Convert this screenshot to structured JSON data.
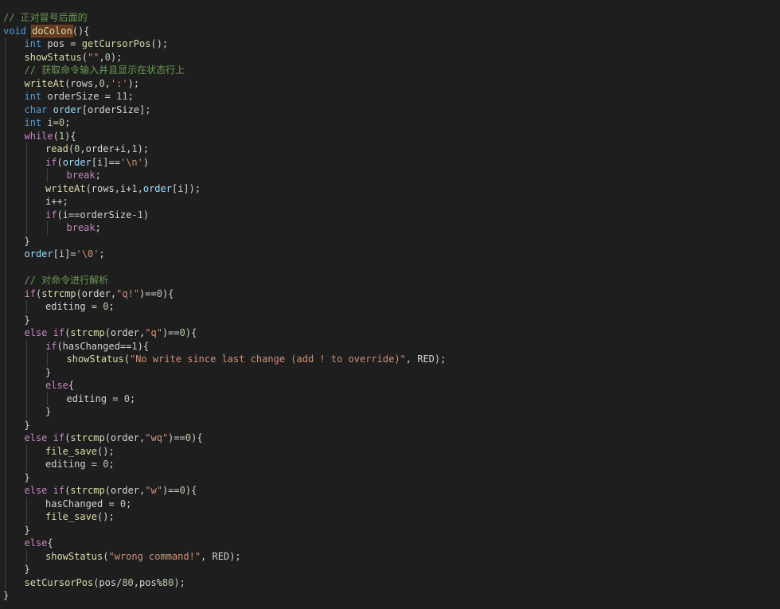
{
  "editor": {
    "lines": [
      {
        "indent": 0,
        "tokens": [
          {
            "t": "// 正对冒号后面的",
            "c": "comment"
          }
        ]
      },
      {
        "indent": 0,
        "tokens": [
          {
            "t": "void",
            "c": "keyword"
          },
          {
            "t": " ",
            "c": "plain"
          },
          {
            "t": "doColon",
            "c": "func",
            "hl": true
          },
          {
            "t": "(){",
            "c": "plain"
          }
        ]
      },
      {
        "indent": 1,
        "tokens": [
          {
            "t": "int",
            "c": "keyword"
          },
          {
            "t": " pos = ",
            "c": "plain"
          },
          {
            "t": "getCursorPos",
            "c": "func"
          },
          {
            "t": "();",
            "c": "plain"
          }
        ]
      },
      {
        "indent": 1,
        "tokens": [
          {
            "t": "showStatus",
            "c": "func"
          },
          {
            "t": "(",
            "c": "plain"
          },
          {
            "t": "\"\"",
            "c": "str"
          },
          {
            "t": ",",
            "c": "plain"
          },
          {
            "t": "0",
            "c": "num"
          },
          {
            "t": ");",
            "c": "plain"
          }
        ]
      },
      {
        "indent": 1,
        "tokens": [
          {
            "t": "// 获取命令输入并且显示在状态行上",
            "c": "comment"
          }
        ]
      },
      {
        "indent": 1,
        "tokens": [
          {
            "t": "writeAt",
            "c": "func"
          },
          {
            "t": "(rows,",
            "c": "plain"
          },
          {
            "t": "0",
            "c": "num"
          },
          {
            "t": ",",
            "c": "plain"
          },
          {
            "t": "':'",
            "c": "str"
          },
          {
            "t": ");",
            "c": "plain"
          }
        ]
      },
      {
        "indent": 1,
        "tokens": [
          {
            "t": "int",
            "c": "keyword"
          },
          {
            "t": " orderSize = ",
            "c": "plain"
          },
          {
            "t": "11",
            "c": "num"
          },
          {
            "t": ";",
            "c": "plain"
          }
        ]
      },
      {
        "indent": 1,
        "tokens": [
          {
            "t": "char",
            "c": "keyword"
          },
          {
            "t": " ",
            "c": "plain"
          },
          {
            "t": "order",
            "c": "var"
          },
          {
            "t": "[orderSize];",
            "c": "plain"
          }
        ]
      },
      {
        "indent": 1,
        "tokens": [
          {
            "t": "int",
            "c": "keyword"
          },
          {
            "t": " i=",
            "c": "plain"
          },
          {
            "t": "0",
            "c": "num"
          },
          {
            "t": ";",
            "c": "plain"
          }
        ]
      },
      {
        "indent": 1,
        "tokens": [
          {
            "t": "while",
            "c": "control"
          },
          {
            "t": "(",
            "c": "plain"
          },
          {
            "t": "1",
            "c": "num"
          },
          {
            "t": "){",
            "c": "plain"
          }
        ]
      },
      {
        "indent": 2,
        "tokens": [
          {
            "t": "read",
            "c": "func"
          },
          {
            "t": "(",
            "c": "plain"
          },
          {
            "t": "0",
            "c": "num"
          },
          {
            "t": ",order+i,",
            "c": "plain"
          },
          {
            "t": "1",
            "c": "num"
          },
          {
            "t": ");",
            "c": "plain"
          }
        ]
      },
      {
        "indent": 2,
        "tokens": [
          {
            "t": "if",
            "c": "control"
          },
          {
            "t": "(",
            "c": "plain"
          },
          {
            "t": "order",
            "c": "var"
          },
          {
            "t": "[i]==",
            "c": "plain"
          },
          {
            "t": "'\\n'",
            "c": "str"
          },
          {
            "t": ")",
            "c": "plain"
          }
        ]
      },
      {
        "indent": 3,
        "tokens": [
          {
            "t": "break",
            "c": "control"
          },
          {
            "t": ";",
            "c": "plain"
          }
        ]
      },
      {
        "indent": 2,
        "tokens": [
          {
            "t": "writeAt",
            "c": "func"
          },
          {
            "t": "(rows,i+",
            "c": "plain"
          },
          {
            "t": "1",
            "c": "num"
          },
          {
            "t": ",",
            "c": "plain"
          },
          {
            "t": "order",
            "c": "var"
          },
          {
            "t": "[i]);",
            "c": "plain"
          }
        ]
      },
      {
        "indent": 2,
        "tokens": [
          {
            "t": "i++;",
            "c": "plain"
          }
        ]
      },
      {
        "indent": 2,
        "tokens": [
          {
            "t": "if",
            "c": "control"
          },
          {
            "t": "(i==orderSize-",
            "c": "plain"
          },
          {
            "t": "1",
            "c": "num"
          },
          {
            "t": ")",
            "c": "plain"
          }
        ]
      },
      {
        "indent": 3,
        "tokens": [
          {
            "t": "break",
            "c": "control"
          },
          {
            "t": ";",
            "c": "plain"
          }
        ]
      },
      {
        "indent": 1,
        "tokens": [
          {
            "t": "}",
            "c": "plain"
          }
        ]
      },
      {
        "indent": 1,
        "tokens": [
          {
            "t": "order",
            "c": "var"
          },
          {
            "t": "[i]=",
            "c": "plain"
          },
          {
            "t": "'\\0'",
            "c": "str"
          },
          {
            "t": ";",
            "c": "plain"
          }
        ]
      },
      {
        "indent": 0,
        "tokens": []
      },
      {
        "indent": 1,
        "tokens": [
          {
            "t": "// 对命令进行解析",
            "c": "comment"
          }
        ]
      },
      {
        "indent": 1,
        "tokens": [
          {
            "t": "if",
            "c": "control"
          },
          {
            "t": "(",
            "c": "plain"
          },
          {
            "t": "strcmp",
            "c": "func"
          },
          {
            "t": "(order,",
            "c": "plain"
          },
          {
            "t": "\"q!\"",
            "c": "str"
          },
          {
            "t": ")==",
            "c": "plain"
          },
          {
            "t": "0",
            "c": "num"
          },
          {
            "t": "){",
            "c": "plain"
          }
        ]
      },
      {
        "indent": 2,
        "tokens": [
          {
            "t": "editing = ",
            "c": "plain"
          },
          {
            "t": "0",
            "c": "num"
          },
          {
            "t": ";",
            "c": "plain"
          }
        ]
      },
      {
        "indent": 1,
        "tokens": [
          {
            "t": "}",
            "c": "plain"
          }
        ]
      },
      {
        "indent": 1,
        "tokens": [
          {
            "t": "else",
            "c": "control"
          },
          {
            "t": " ",
            "c": "plain"
          },
          {
            "t": "if",
            "c": "control"
          },
          {
            "t": "(",
            "c": "plain"
          },
          {
            "t": "strcmp",
            "c": "func"
          },
          {
            "t": "(order,",
            "c": "plain"
          },
          {
            "t": "\"q\"",
            "c": "str"
          },
          {
            "t": ")==",
            "c": "plain"
          },
          {
            "t": "0",
            "c": "num"
          },
          {
            "t": "){",
            "c": "plain"
          }
        ]
      },
      {
        "indent": 2,
        "tokens": [
          {
            "t": "if",
            "c": "control"
          },
          {
            "t": "(hasChanged==",
            "c": "plain"
          },
          {
            "t": "1",
            "c": "num"
          },
          {
            "t": "){",
            "c": "plain"
          }
        ]
      },
      {
        "indent": 3,
        "tokens": [
          {
            "t": "showStatus",
            "c": "func"
          },
          {
            "t": "(",
            "c": "plain"
          },
          {
            "t": "\"No write since last change (add ! to override)\"",
            "c": "str"
          },
          {
            "t": ", RED);",
            "c": "plain"
          }
        ]
      },
      {
        "indent": 2,
        "tokens": [
          {
            "t": "}",
            "c": "plain"
          }
        ]
      },
      {
        "indent": 2,
        "tokens": [
          {
            "t": "else",
            "c": "control"
          },
          {
            "t": "{",
            "c": "plain"
          }
        ]
      },
      {
        "indent": 3,
        "tokens": [
          {
            "t": "editing = ",
            "c": "plain"
          },
          {
            "t": "0",
            "c": "num"
          },
          {
            "t": ";",
            "c": "plain"
          }
        ]
      },
      {
        "indent": 2,
        "tokens": [
          {
            "t": "}",
            "c": "plain"
          }
        ]
      },
      {
        "indent": 1,
        "tokens": [
          {
            "t": "}",
            "c": "plain"
          }
        ]
      },
      {
        "indent": 1,
        "tokens": [
          {
            "t": "else",
            "c": "control"
          },
          {
            "t": " ",
            "c": "plain"
          },
          {
            "t": "if",
            "c": "control"
          },
          {
            "t": "(",
            "c": "plain"
          },
          {
            "t": "strcmp",
            "c": "func"
          },
          {
            "t": "(order,",
            "c": "plain"
          },
          {
            "t": "\"wq\"",
            "c": "str"
          },
          {
            "t": ")==",
            "c": "plain"
          },
          {
            "t": "0",
            "c": "num"
          },
          {
            "t": "){",
            "c": "plain"
          }
        ]
      },
      {
        "indent": 2,
        "tokens": [
          {
            "t": "file_save",
            "c": "func"
          },
          {
            "t": "();",
            "c": "plain"
          }
        ]
      },
      {
        "indent": 2,
        "tokens": [
          {
            "t": "editing = ",
            "c": "plain"
          },
          {
            "t": "0",
            "c": "num"
          },
          {
            "t": ";",
            "c": "plain"
          }
        ]
      },
      {
        "indent": 1,
        "tokens": [
          {
            "t": "}",
            "c": "plain"
          }
        ]
      },
      {
        "indent": 1,
        "tokens": [
          {
            "t": "else",
            "c": "control"
          },
          {
            "t": " ",
            "c": "plain"
          },
          {
            "t": "if",
            "c": "control"
          },
          {
            "t": "(",
            "c": "plain"
          },
          {
            "t": "strcmp",
            "c": "func"
          },
          {
            "t": "(order,",
            "c": "plain"
          },
          {
            "t": "\"w\"",
            "c": "str"
          },
          {
            "t": ")==",
            "c": "plain"
          },
          {
            "t": "0",
            "c": "num"
          },
          {
            "t": "){",
            "c": "plain"
          }
        ]
      },
      {
        "indent": 2,
        "tokens": [
          {
            "t": "hasChanged = ",
            "c": "plain"
          },
          {
            "t": "0",
            "c": "num"
          },
          {
            "t": ";",
            "c": "plain"
          }
        ]
      },
      {
        "indent": 2,
        "tokens": [
          {
            "t": "file_save",
            "c": "func"
          },
          {
            "t": "();",
            "c": "plain"
          }
        ]
      },
      {
        "indent": 1,
        "tokens": [
          {
            "t": "}",
            "c": "plain"
          }
        ]
      },
      {
        "indent": 1,
        "tokens": [
          {
            "t": "else",
            "c": "control"
          },
          {
            "t": "{",
            "c": "plain"
          }
        ]
      },
      {
        "indent": 2,
        "tokens": [
          {
            "t": "showStatus",
            "c": "func"
          },
          {
            "t": "(",
            "c": "plain"
          },
          {
            "t": "\"wrong command!\"",
            "c": "str"
          },
          {
            "t": ", RED);",
            "c": "plain"
          }
        ]
      },
      {
        "indent": 1,
        "tokens": [
          {
            "t": "}",
            "c": "plain"
          }
        ]
      },
      {
        "indent": 1,
        "tokens": [
          {
            "t": "setCursorPos",
            "c": "func"
          },
          {
            "t": "(pos/",
            "c": "plain"
          },
          {
            "t": "80",
            "c": "num"
          },
          {
            "t": ",pos%",
            "c": "plain"
          },
          {
            "t": "80",
            "c": "num"
          },
          {
            "t": ");",
            "c": "plain"
          }
        ]
      },
      {
        "indent": 0,
        "tokens": [
          {
            "t": "}",
            "c": "plain"
          }
        ]
      }
    ]
  },
  "theme": {
    "background": "#1e1e1e",
    "comment": "#6a9955",
    "keyword": "#569cd6",
    "control": "#c586c0",
    "function": "#dcdcaa",
    "variable": "#9cdcfe",
    "number": "#b5cea8",
    "string": "#ce9178",
    "plain": "#d4d4d4",
    "indent_guide": "#404040",
    "word_highlight": "#613a1f"
  }
}
